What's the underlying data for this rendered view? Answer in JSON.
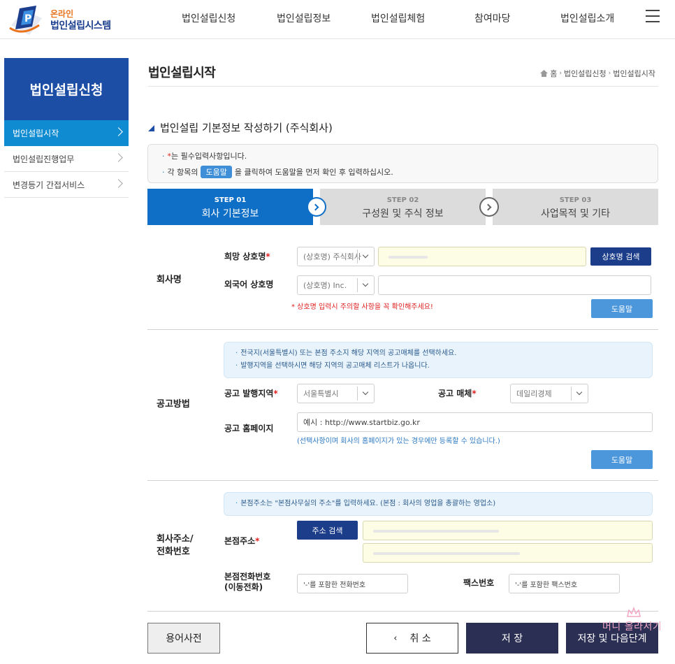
{
  "header": {
    "logo_line1": "온라인",
    "logo_line2": "법인설립시스템",
    "nav": [
      "법인설립신청",
      "법인설립정보",
      "법인설립체험",
      "참여마당",
      "법인설립소개"
    ]
  },
  "sidebar": {
    "title": "법인설립신청",
    "items": [
      {
        "label": "법인설립시작",
        "active": true
      },
      {
        "label": "법인설립진행업무",
        "active": false
      },
      {
        "label": "변경등기 간접서비스",
        "active": false
      }
    ]
  },
  "page": {
    "title": "법인설립시작",
    "breadcrumb": [
      "홈",
      "법인설립신청",
      "법인설립시작"
    ],
    "section_title": "법인설립 기본정보 작성하기 (주식회사)"
  },
  "notice": {
    "line1_star": "*",
    "line1": "는 필수입력사항입니다.",
    "line2_pre": "각 항목의",
    "line2_chip": "도움말",
    "line2_post": "을 클릭하여 도움말을 먼저 확인 후 입력하십시오."
  },
  "steps": [
    {
      "num": "STEP 01",
      "title": "회사 기본정보",
      "active": true
    },
    {
      "num": "STEP 02",
      "title": "구성원 및 주식 정보",
      "active": false
    },
    {
      "num": "STEP 03",
      "title": "사업목적 및 기타",
      "active": false
    }
  ],
  "company_name": {
    "group_label": "회사명",
    "desired_label": "희망 상호명",
    "desired_select": "(상호명) 주식회사",
    "search_button": "상호명 검색",
    "foreign_label": "외국어 상호명",
    "foreign_select": "(상호명) Inc.",
    "warning": "* 상호명 입력시 주의할 사항을 꼭 확인해주세요!",
    "help_button": "도움말"
  },
  "announcement": {
    "group_label": "공고방법",
    "info": [
      "전국지(서울특별시) 또는 본점 주소지 해당 지역의 공고매체를 선택하세요.",
      "발행지역을 선택하시면 해당 지역의 공고매체 리스트가 나옵니다."
    ],
    "region_label": "공고 발행지역",
    "region_value": "서울특별시",
    "media_label": "공고 매체",
    "media_value": "데일리경제",
    "homepage_label": "공고 홈페이지",
    "homepage_placeholder": "예시 : http://www.startbiz.go.kr",
    "homepage_note": "(선택사항이며 회사의 홈페이지가 있는 경우에만 등록할 수 있습니다.)",
    "help_button": "도움말"
  },
  "address": {
    "group_label_1": "회사주소/",
    "group_label_2": "전화번호",
    "info": "본점주소는 \"본점사무실의 주소\"를 입력하세요. (본점 : 회사의 영업을 총괄하는 영업소)",
    "address_label": "본점주소",
    "search_button": "주소 검색",
    "phone_label_1": "본점전화번호",
    "phone_label_2": "(이동전화)",
    "phone_placeholder": "'-'를 포함한 전화번호",
    "fax_label": "팩스번호",
    "fax_placeholder": "'-'를 포함한 팩스번호"
  },
  "bottom": {
    "dictionary": "용어사전",
    "cancel": "취 소",
    "save": "저 장",
    "save_next": "저장 및 다음단계",
    "watermark": "머니 올라서기"
  },
  "colors": {
    "brand_navy": "#1c4ea5",
    "active_blue": "#0f8bd1",
    "step_active": "#0f6fc6",
    "required_red": "#e02020",
    "button_dark": "#2b2f54"
  }
}
